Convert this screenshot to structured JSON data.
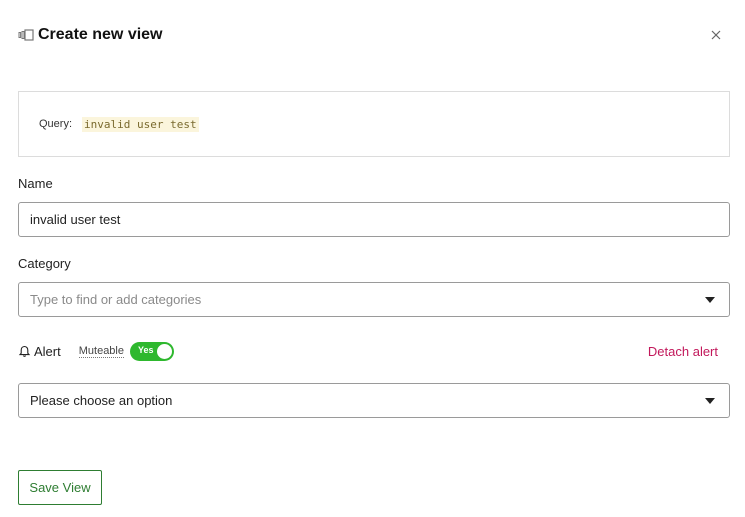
{
  "dialog": {
    "title": "Create new view",
    "icon": "view-icon",
    "close_icon": "close-icon"
  },
  "query": {
    "label": "Query:",
    "value": "invalid user test"
  },
  "name_field": {
    "label": "Name",
    "value": "invalid user test"
  },
  "category_field": {
    "label": "Category",
    "placeholder": "Type to find or add categories"
  },
  "alert": {
    "label": "Alert",
    "icon": "bell-icon",
    "muteable_label": "Muteable",
    "toggle_label": "Yes",
    "toggle_on": true,
    "toggle_color": "#2eb82e",
    "detach_label": "Detach alert",
    "detach_color": "#c2185b"
  },
  "option_select": {
    "selected": "Please choose an option"
  },
  "actions": {
    "save_label": "Save View",
    "save_color": "#2e7d32"
  }
}
